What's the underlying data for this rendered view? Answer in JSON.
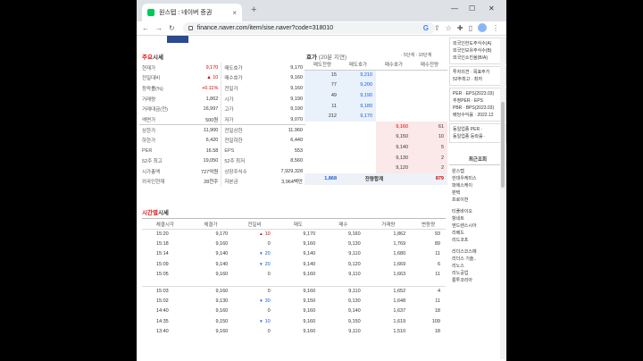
{
  "browser": {
    "tab_title": "원스텝 : 네이버 증권",
    "url": "finance.naver.com/item/sise.naver?code=318010",
    "new_tab": "+",
    "tab_close": "×",
    "win_min": "—",
    "win_max": "☐",
    "win_close": "✕"
  },
  "quote_section": {
    "title_prefix": "주요",
    "title": "시세",
    "left_rows": [
      {
        "k": "현재가",
        "v": "9,170",
        "k2": "매도호가",
        "v2": "9,170"
      },
      {
        "k": "전일대비",
        "v": "10",
        "k2": "매수호가",
        "v2": "9,160"
      },
      {
        "k": "등락률(%)",
        "v": "+0.11%",
        "k2": "전일가",
        "v2": "9,160"
      },
      {
        "k": "거래량",
        "v": "1,862",
        "k2": "시가",
        "v2": "9,190"
      },
      {
        "k": "거래대금(천)",
        "v": "16,997",
        "k2": "고가",
        "v2": "9,190"
      },
      {
        "k": "액면가",
        "v": "500원",
        "k2": "저가",
        "v2": "9,070"
      },
      {
        "k": "상한가",
        "v": "11,900",
        "k2": "전일상한",
        "v2": "11,960"
      },
      {
        "k": "하한가",
        "v": "6,420",
        "k2": "전일하한",
        "v2": "6,440"
      },
      {
        "k": "PER",
        "v": "16.58",
        "k2": "EPS",
        "v2": "553"
      },
      {
        "k": "52주 최고",
        "v": "19,050",
        "k2": "52주 최저",
        "v2": "8,560"
      },
      {
        "k": "시가총액",
        "v": "727억원",
        "k2": "상장주식수",
        "v2": "7,929,328"
      },
      {
        "k": "외국인현재",
        "v": "28천주",
        "k2": "자본금",
        "v2": "3,964백만"
      }
    ]
  },
  "orderbook": {
    "title_prefix": "호가",
    "title_sub": "(20분 지연)",
    "links": "· 5단계 · 10단계",
    "headers": [
      "매도잔량",
      "매도호가",
      "매수호가",
      "매수잔량"
    ],
    "asks": [
      {
        "qty": "15",
        "price": "9,210"
      },
      {
        "qty": "77",
        "price": "9,200"
      },
      {
        "qty": "49",
        "price": "9,190"
      },
      {
        "qty": "11",
        "price": "9,180"
      },
      {
        "qty": "212",
        "price": "9,170"
      }
    ],
    "bids": [
      {
        "price": "9,160",
        "qty": "61"
      },
      {
        "price": "9,150",
        "qty": "10"
      },
      {
        "price": "9,140",
        "qty": "5"
      },
      {
        "price": "9,130",
        "qty": "2"
      },
      {
        "price": "9,120",
        "qty": "2"
      }
    ],
    "total_ask": "1,868",
    "total_label": "잔량합계",
    "total_bid": "879"
  },
  "time_section": {
    "title_prefix": "시간별",
    "title": "시세",
    "headers": [
      "체결시각",
      "체결가",
      "전일비",
      "매도",
      "매수",
      "거래량",
      "변동량"
    ],
    "rows": [
      {
        "t": "15:20",
        "p": "9,170",
        "dir": "up",
        "c": "10",
        "s": "9,170",
        "b": "9,160",
        "vol": "1,862",
        "d": "93"
      },
      {
        "t": "15:18",
        "p": "9,160",
        "dir": "",
        "c": "0",
        "s": "9,160",
        "b": "9,130",
        "vol": "1,769",
        "d": "89"
      },
      {
        "t": "15:14",
        "p": "9,140",
        "dir": "dn",
        "c": "20",
        "s": "9,140",
        "b": "9,110",
        "vol": "1,680",
        "d": "11"
      },
      {
        "t": "15:09",
        "p": "9,140",
        "dir": "dn",
        "c": "20",
        "s": "9,140",
        "b": "9,120",
        "vol": "1,669",
        "d": "6"
      },
      {
        "t": "15:05",
        "p": "9,160",
        "dir": "",
        "c": "0",
        "s": "9,160",
        "b": "9,110",
        "vol": "1,663",
        "d": "11"
      },
      {
        "gap": true
      },
      {
        "t": "15:03",
        "p": "9,160",
        "dir": "",
        "c": "0",
        "s": "9,160",
        "b": "9,110",
        "vol": "1,652",
        "d": "4"
      },
      {
        "t": "15:02",
        "p": "9,130",
        "dir": "dn",
        "c": "30",
        "s": "9,150",
        "b": "9,130",
        "vol": "1,648",
        "d": "11"
      },
      {
        "t": "14:40",
        "p": "9,160",
        "dir": "",
        "c": "0",
        "s": "9,160",
        "b": "9,140",
        "vol": "1,637",
        "d": "18"
      },
      {
        "t": "14:35",
        "p": "9,150",
        "dir": "dn",
        "c": "10",
        "s": "9,160",
        "b": "9,150",
        "vol": "1,619",
        "d": "109"
      },
      {
        "t": "13:40",
        "p": "9,160",
        "dir": "",
        "c": "0",
        "s": "9,160",
        "b": "9,110",
        "vol": "1,510",
        "d": "18"
      }
    ]
  },
  "right_panel": {
    "top_links": [
      "외국인한도주식수(A)",
      "외국인보유주식수(B)",
      "외국인소진율(B/A)"
    ],
    "opinion": [
      "투자의견 · 목표주가",
      "52주최고 · 최저"
    ],
    "per": [
      "PER · EPS(2023.03)",
      "추정PER · EPS",
      "PBR · BPS(2023.03)",
      "배당수익률 · 2022.12"
    ],
    "industry": [
      "동일업종 PER ·",
      "동일업종 등락률 ·"
    ],
    "recent_title": "최근조회",
    "recent_items": [
      "원스텝",
      "한대우케미스",
      "파에스케이",
      "판택",
      "프로이천",
      "",
      "티플바이오",
      "항네트",
      "엔드렌스시아",
      "리베드",
      "리드코프",
      "",
      "리더스코스메",
      "리더스 기술..",
      "리노스",
      "리노공업",
      "룽투코리아"
    ]
  },
  "colors": {
    "up": "#d40000",
    "down": "#1a5ed8",
    "ask_bg": "#e9f1fb",
    "bid_bg": "#fbe8e8"
  }
}
